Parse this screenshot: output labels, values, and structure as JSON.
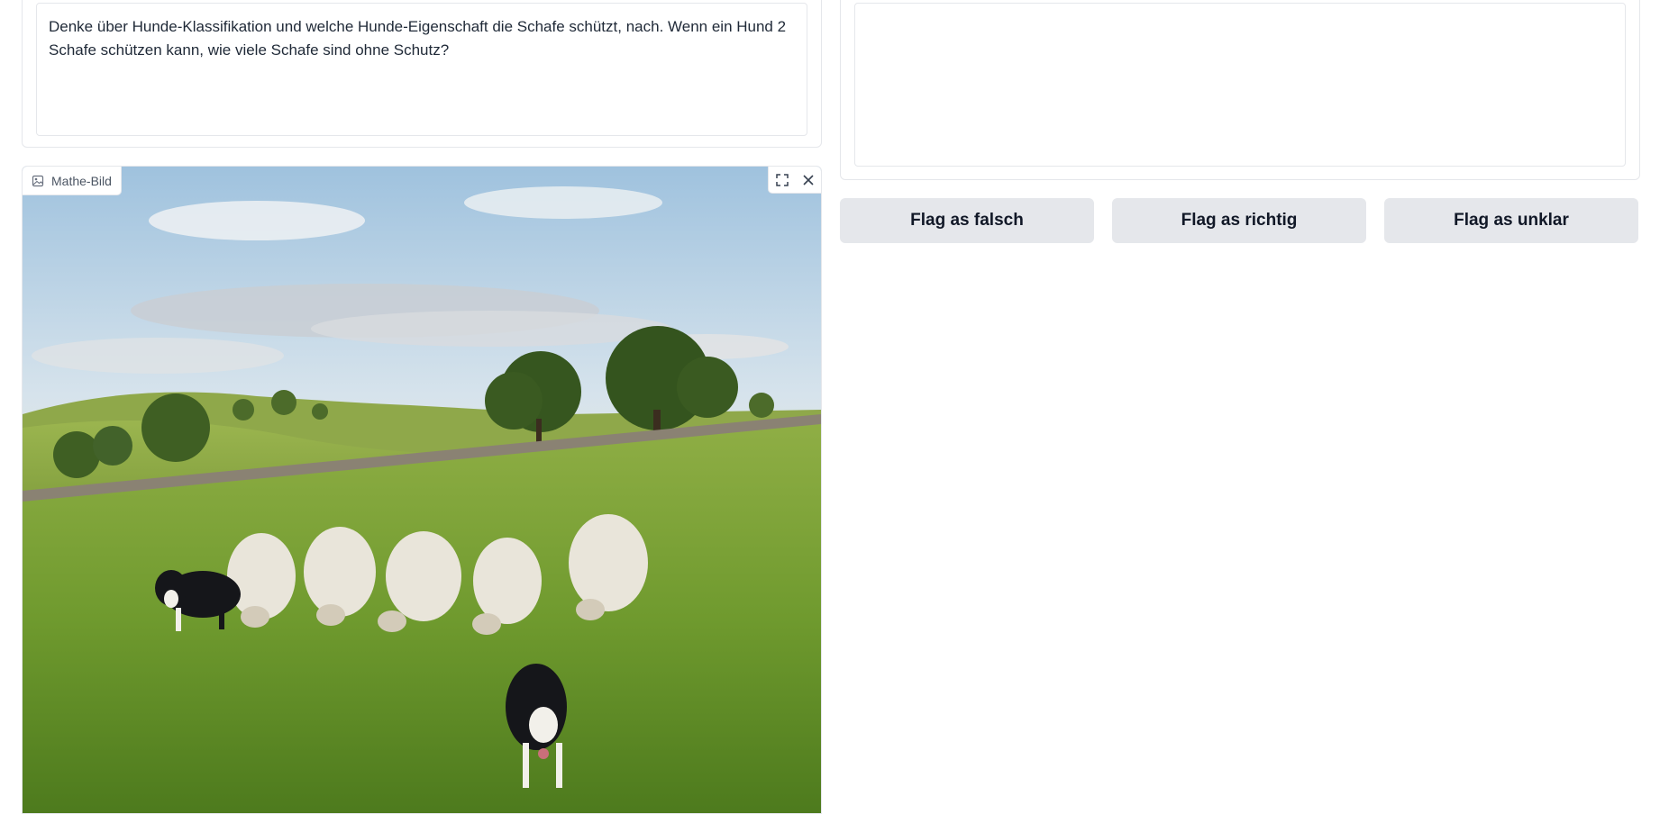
{
  "question": {
    "text": "Denke über Hunde-Klassifikation und welche Hunde-Eigenschaft die Schafe schützt, nach. Wenn ein Hund 2 Schafe schützen kann, wie viele Schafe sind ohne Schutz?"
  },
  "image_panel": {
    "label": "Mathe-Bild",
    "label_icon": "image-icon",
    "tools": [
      "fullscreen-icon",
      "close-icon"
    ]
  },
  "answer": {
    "value": ""
  },
  "flag_buttons": {
    "falsch": "Flag as falsch",
    "richtig": "Flag as richtig",
    "unklar": "Flag as unklar"
  },
  "colors": {
    "border": "#e5e7eb",
    "button_bg": "#e5e7eb",
    "text": "#1f2937"
  }
}
